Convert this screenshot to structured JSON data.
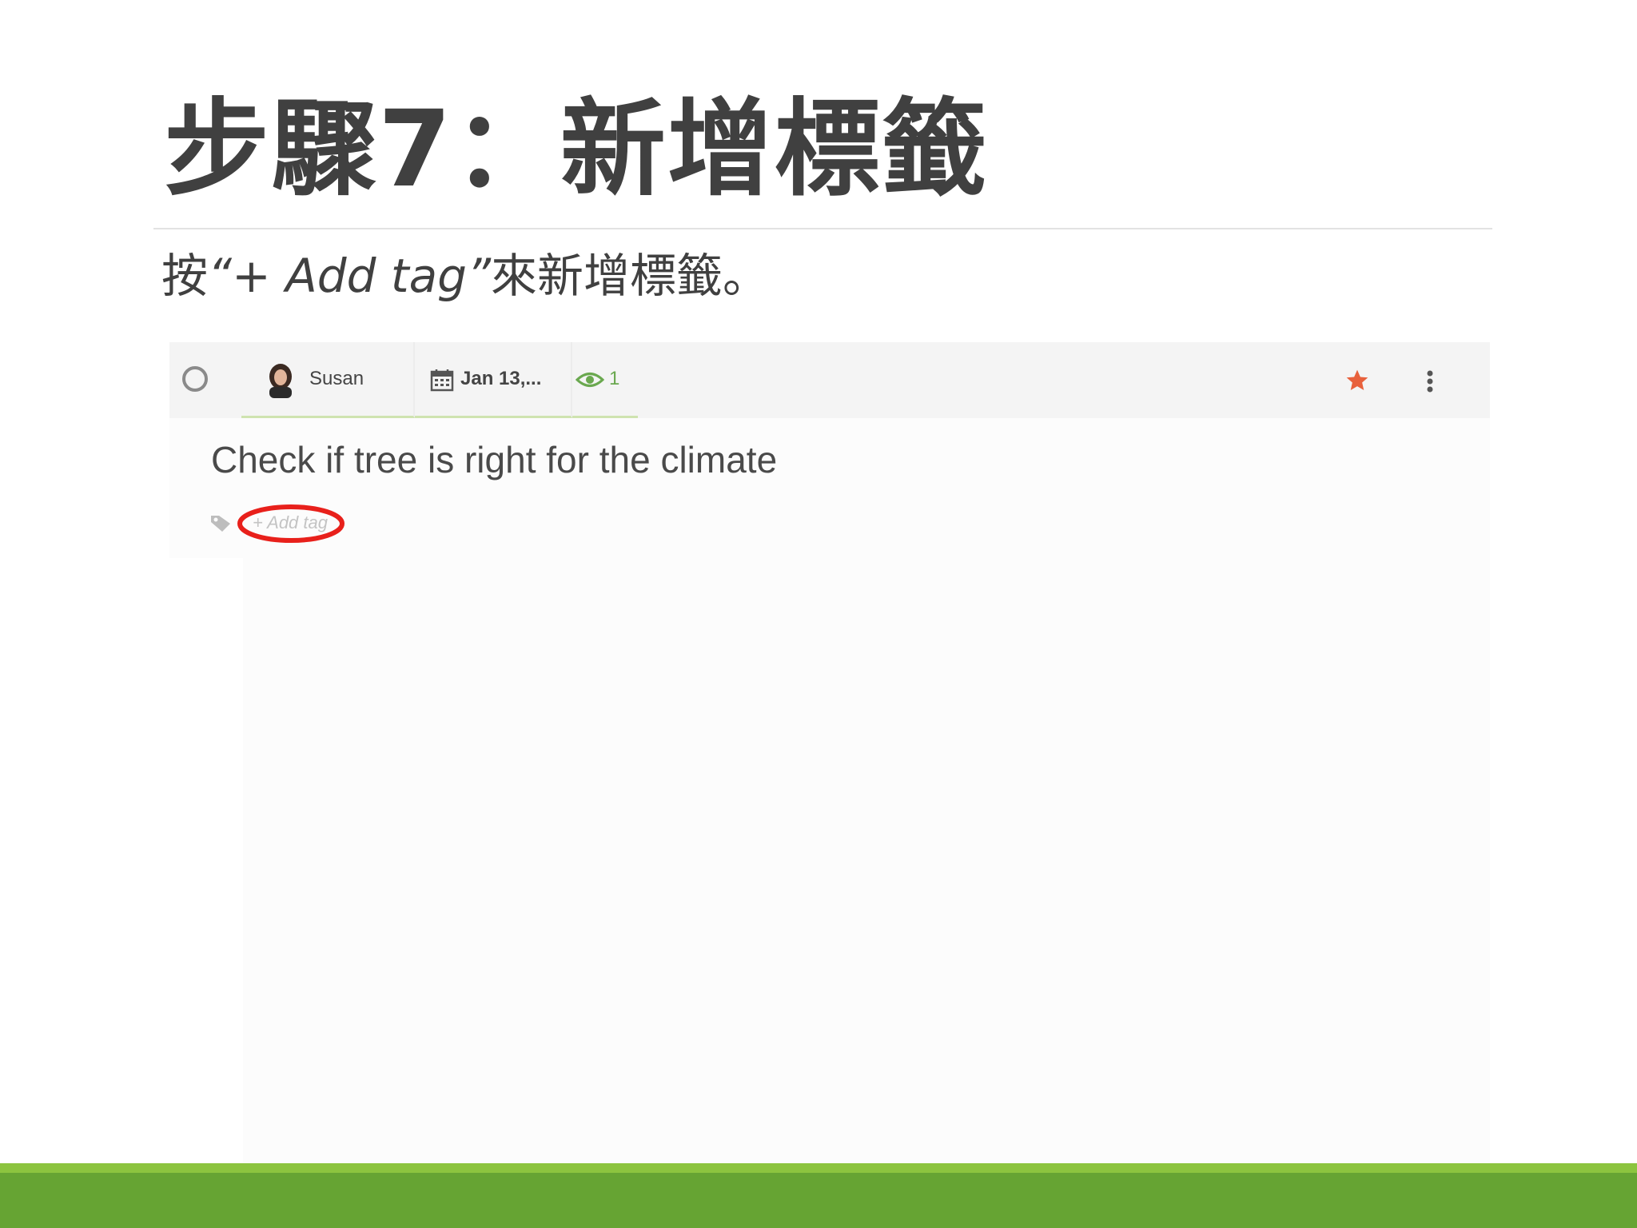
{
  "slide": {
    "title": "步驟7：新增標籤",
    "subtitle_pre": "按",
    "subtitle_quoted": "“+ Add tag”",
    "subtitle_post": "來新增標籤。"
  },
  "task": {
    "user": "Susan",
    "date": "Jan 13,...",
    "watchers": "1",
    "title": "Check if tree is right for the climate",
    "add_tag": "+ Add tag"
  },
  "colors": {
    "accent_green": "#66a433",
    "accent_green_light": "#8cc43f",
    "highlight_red": "#e8201b",
    "star": "#e8613c",
    "eye_green": "#6aa84f"
  },
  "icons": [
    "complete-circle-icon",
    "avatar",
    "calendar-icon",
    "eye-icon",
    "star-icon",
    "more-vertical-icon",
    "tag-icon"
  ]
}
